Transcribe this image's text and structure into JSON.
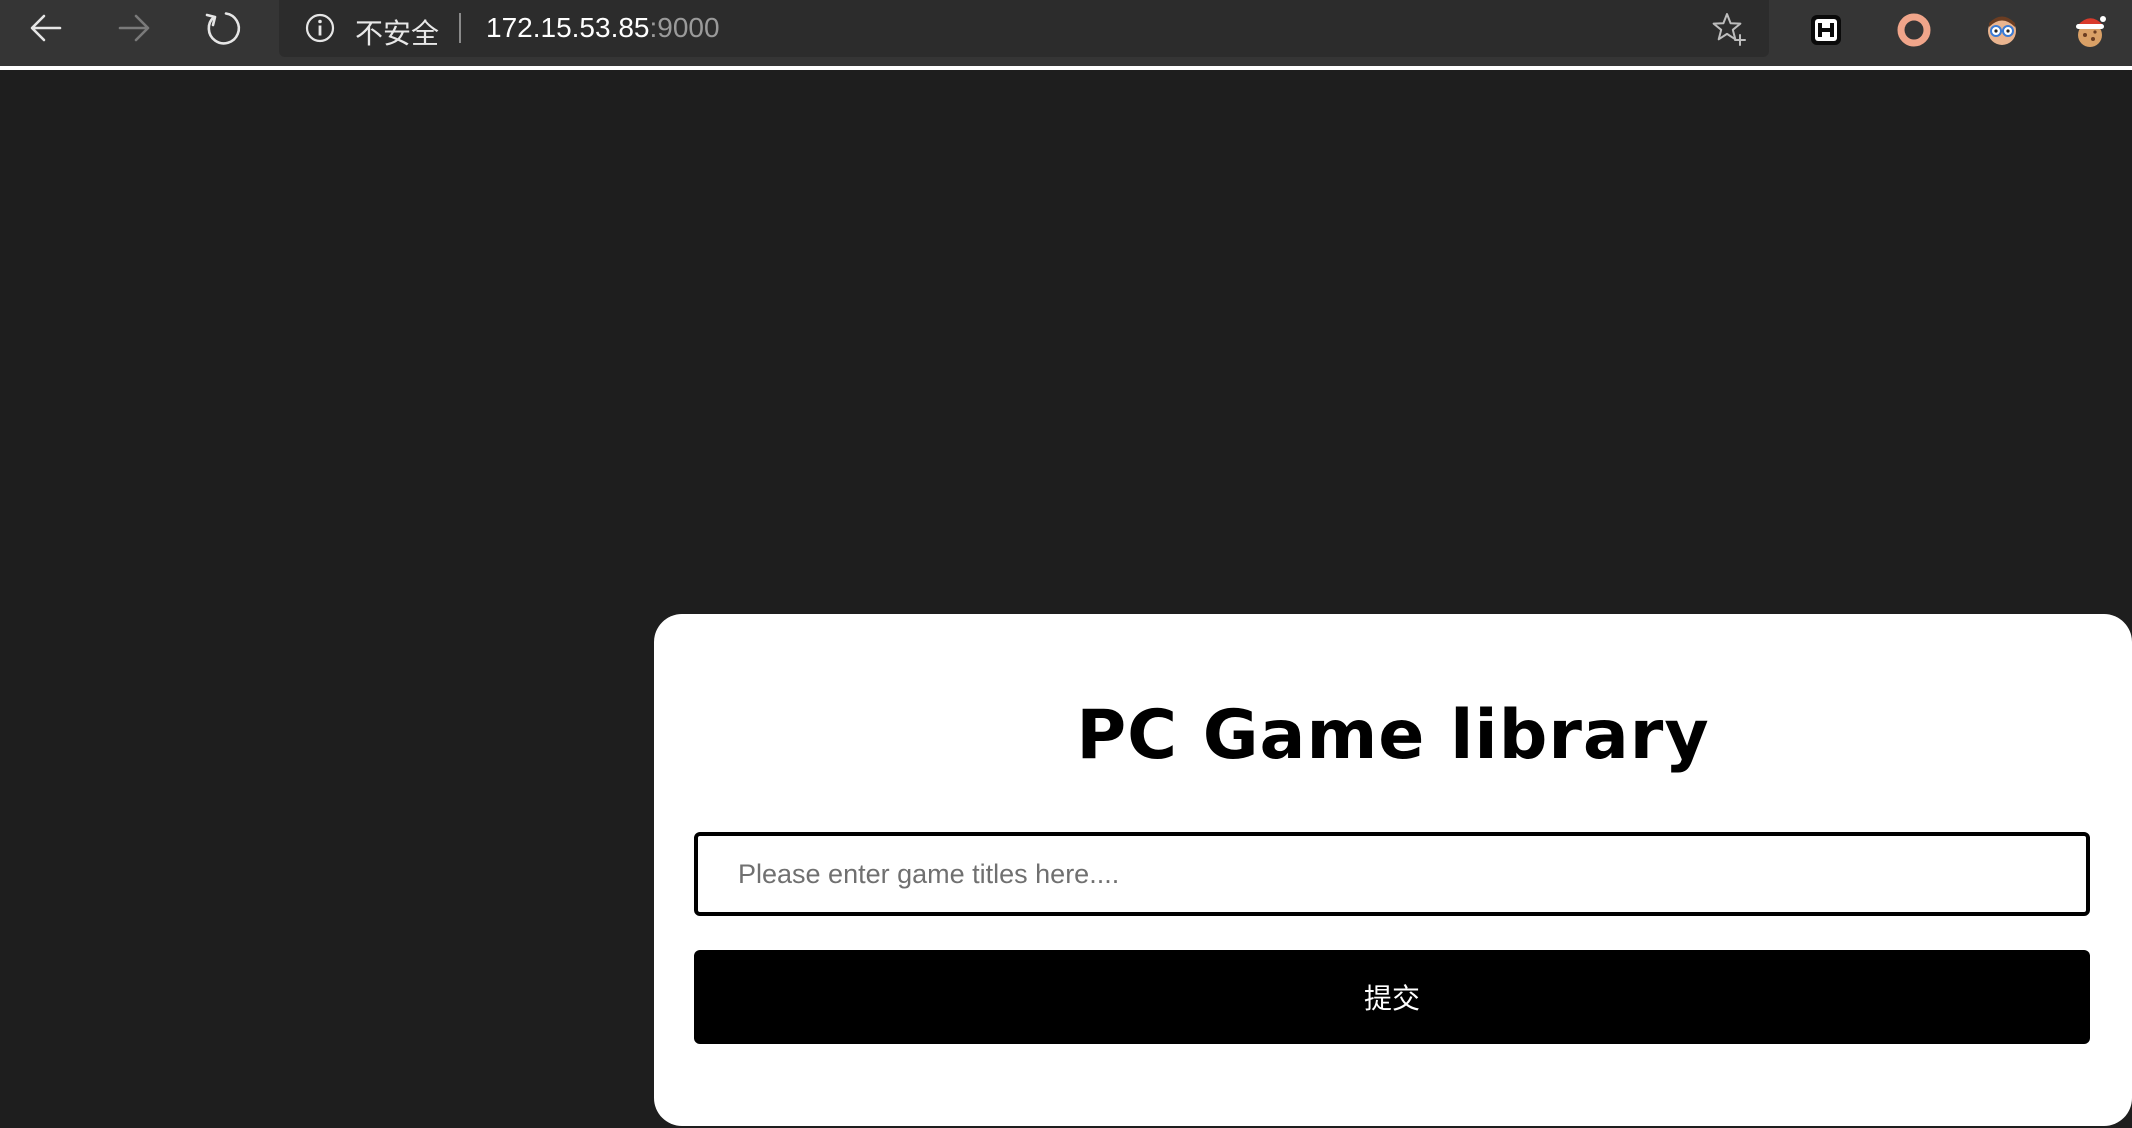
{
  "browser": {
    "security_label": "不安全",
    "url_host": "172.15.53.85",
    "url_port": ":9000",
    "nav": {
      "back_icon": "arrow-left-icon",
      "forward_icon": "arrow-right-icon",
      "reload_icon": "reload-icon"
    },
    "extensions": [
      {
        "name": "h-extension-icon",
        "color": "#000000"
      },
      {
        "name": "ring-extension-icon",
        "color": "#f0a58a"
      },
      {
        "name": "glasses-avatar-extension-icon",
        "color": "#5aa0d8"
      },
      {
        "name": "santa-cookie-extension-icon",
        "color": "#d93a2b"
      }
    ]
  },
  "page": {
    "title": "PC Game library",
    "search_placeholder": "Please enter game titles here....",
    "search_value": "",
    "submit_label": "提交"
  },
  "colors": {
    "page_background": "#1e1e1e",
    "card_background": "#ffffff",
    "button_background": "#000000",
    "toolbar_background": "#353535"
  }
}
